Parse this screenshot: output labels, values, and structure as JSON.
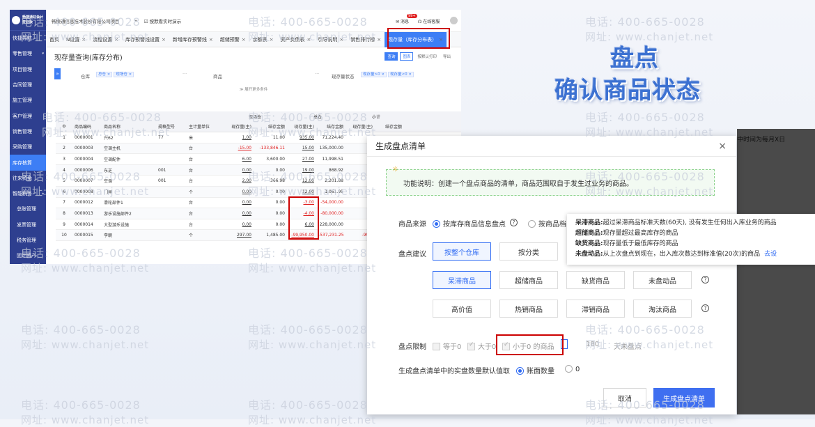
{
  "sidebar": {
    "company_lines": [
      "畅捷通好会计",
      "专业版"
    ],
    "items": [
      {
        "label": "快捷导航",
        "caret": ""
      },
      {
        "label": "零售管理",
        "caret": "▾"
      },
      {
        "label": "项目管理",
        "caret": ""
      },
      {
        "label": "合同管理",
        "caret": ""
      },
      {
        "label": "施工管理",
        "caret": ""
      },
      {
        "label": "客户管理",
        "caret": ""
      },
      {
        "label": "销售管理",
        "caret": ""
      },
      {
        "label": "采购管理",
        "caret": ""
      },
      {
        "label": "库存核算",
        "caret": ""
      },
      {
        "label": "往来资金",
        "caret": ""
      },
      {
        "label": "智能税务",
        "caret": "▴"
      },
      {
        "label": "总账管理",
        "caret": ""
      },
      {
        "label": "发票管理",
        "caret": ""
      },
      {
        "label": "税务管理",
        "caret": ""
      },
      {
        "label": "固定资产",
        "caret": ""
      }
    ]
  },
  "topbar": {
    "company": "畅捷通信息技术股份有限公司项目",
    "dropdown": "▾",
    "demo_check": "按默看实时演示",
    "messages_label": "消息",
    "messages_badge": "99+",
    "service_label": "在线客服"
  },
  "tabs": [
    {
      "label": "首页",
      "close": ""
    },
    {
      "label": "N设置",
      "close": "×"
    },
    {
      "label": "流程设置",
      "close": "×"
    },
    {
      "label": "库存预警线设置",
      "close": "×"
    },
    {
      "label": "新增库存预警线",
      "close": "×"
    },
    {
      "label": "超储预警",
      "close": "×"
    },
    {
      "label": "余额表",
      "close": "×"
    },
    {
      "label": "资产负债表",
      "close": "×"
    },
    {
      "label": "引导说明",
      "close": "×"
    },
    {
      "label": "销售排行榜",
      "close": "×"
    },
    {
      "label": "现存量（库存分布表）",
      "close": "×"
    }
  ],
  "page": {
    "title": "现存量查询(库存分布)",
    "btn_query": "查询",
    "btn_chart": "图表",
    "btn_other": "按默认打印",
    "btn_export": "导出",
    "filter_collapse": "»",
    "warehouse_label": "仓库",
    "warehouse_tags": [
      "总仓 ×",
      "现场仓 ×"
    ],
    "ellipsis": "···",
    "product_label": "商品",
    "status_label": "现存量状态",
    "status_tags": [
      "现存量>0 ×",
      "现存量<0 ×"
    ],
    "expand_more": "≫ 展开更多条件"
  },
  "table": {
    "group_headers": [
      "现场仓",
      "总仓",
      "小计"
    ],
    "headers": [
      "商品编码",
      "商品名称",
      "规格型号",
      "主计量单位",
      "现存量(主)",
      "结存金额",
      "现存量(主)",
      "结存金额",
      "现存量(主)",
      "结存金额"
    ],
    "rows": [
      {
        "no": "1",
        "code": "0000001",
        "name": "兴62",
        "spec": "77",
        "unit": "米",
        "q1": "1.00",
        "a1": "11.00",
        "q2": "935.00",
        "a2": "71,224.40",
        "q3": "",
        "neg1": false,
        "neg2": false
      },
      {
        "no": "2",
        "code": "0000003",
        "name": "空调主机",
        "spec": "",
        "unit": "台",
        "q1": "-15.00",
        "a1": "-133,846.11",
        "q2": "15.00",
        "a2": "135,000.00",
        "q3": "",
        "neg1": true,
        "neg2": false
      },
      {
        "no": "3",
        "code": "0000004",
        "name": "空调配件",
        "spec": "",
        "unit": "台",
        "q1": "6.00",
        "a1": "3,600.00",
        "q2": "27.00",
        "a2": "11,998.51",
        "q3": "",
        "neg1": false,
        "neg2": false
      },
      {
        "no": "4",
        "code": "0000006",
        "name": "东芝",
        "spec": "001",
        "unit": "台",
        "q1": "0.00",
        "a1": "0.00",
        "q2": "19.00",
        "a2": "868.92",
        "q3": "",
        "neg1": false,
        "neg2": false
      },
      {
        "no": "5",
        "code": "0000007",
        "name": "空调",
        "spec": "001",
        "unit": "台",
        "q1": "2.00",
        "a1": "366.98",
        "q2": "12.00",
        "a2": "2,201.88",
        "q3": "",
        "neg1": false,
        "neg2": false
      },
      {
        "no": "6",
        "code": "0000008",
        "name": "门闸",
        "spec": "",
        "unit": "个",
        "q1": "0.00",
        "a1": "0.00",
        "q2": "12.00",
        "a2": "1,061.95",
        "q3": "",
        "neg1": false,
        "neg2": false
      },
      {
        "no": "7",
        "code": "0000012",
        "name": "滑轮部件1",
        "spec": "",
        "unit": "台",
        "q1": "0.00",
        "a1": "0.00",
        "q2": "-3.00",
        "a2": "-54,000.00",
        "q3": "",
        "neg1": false,
        "neg2": true
      },
      {
        "no": "8",
        "code": "0000013",
        "name": "游乐设施部件2",
        "spec": "",
        "unit": "台",
        "q1": "0.00",
        "a1": "0.00",
        "q2": "-4.00",
        "a2": "-80,000.00",
        "q3": "",
        "neg1": false,
        "neg2": true
      },
      {
        "no": "9",
        "code": "0000014",
        "name": "大型游乐设施",
        "spec": "",
        "unit": "台",
        "q1": "0.00",
        "a1": "0.00",
        "q2": "6.00",
        "a2": "228,000.00",
        "q3": "",
        "neg1": false,
        "neg2": false
      },
      {
        "no": "10",
        "code": "0000015",
        "name": "李朝",
        "spec": "",
        "unit": "个",
        "q1": "297.00",
        "a1": "1,485.00",
        "q2": "-99,950.00",
        "a2": "-537,231.25",
        "q3": "-99,6",
        "neg1": false,
        "neg2": true
      }
    ]
  },
  "overlay_title": {
    "line1": "盘点",
    "line2": "确认商品状态"
  },
  "modal": {
    "title": "生成盘点清单",
    "close": "×",
    "notice_icon": "☼",
    "notice": "功能说明：创建一个盘点商品的清单，商品范围取自于发生过业务的商品。",
    "source_label": "商品来源",
    "source_opt1": "按库存商品信息盘点",
    "source_opt2": "按商品档",
    "suggest_label": "盘点建议",
    "suggest_row1": [
      "按整个仓库",
      "按分类"
    ],
    "suggest_row2": [
      "呆滞商品",
      "超储商品",
      "缺货商品",
      "未盘动品"
    ],
    "suggest_row3": [
      "高价值",
      "热销商品",
      "滞销商品",
      "淘汰商品"
    ],
    "limit_label": "盘点限制",
    "limit_eq": "等于0",
    "limit_gt": "大于0",
    "limit_lt": "小于0 的商品",
    "limit_days": "180",
    "limit_days_suffix": "天未盘点",
    "default_label": "生成盘点清单中的实盘数量默认值取",
    "default_opt1": "账面数量",
    "default_opt2": "0",
    "btn_cancel": "取消",
    "btn_ok": "生成盘点清单"
  },
  "tooltip": [
    {
      "term": "呆滞商品:",
      "desc": "超过呆滞商品标准天数(60天), 没有发生任何出入库业务的商品",
      "link": ""
    },
    {
      "term": "超储商品:",
      "desc": "现存量超过最高库存的商品",
      "link": ""
    },
    {
      "term": "缺货商品:",
      "desc": "现存量低于最低库存的商品",
      "link": ""
    },
    {
      "term": "未盘动品:",
      "desc": "从上次盘点到现在，出入库次数达到标准值(20次)的商品",
      "link": "去设"
    }
  ],
  "bg_right_text": "中时间为每月X日",
  "watermarks": {
    "phone": "电话: 400-665-0028",
    "site": "网址: www.chanjet.net"
  }
}
